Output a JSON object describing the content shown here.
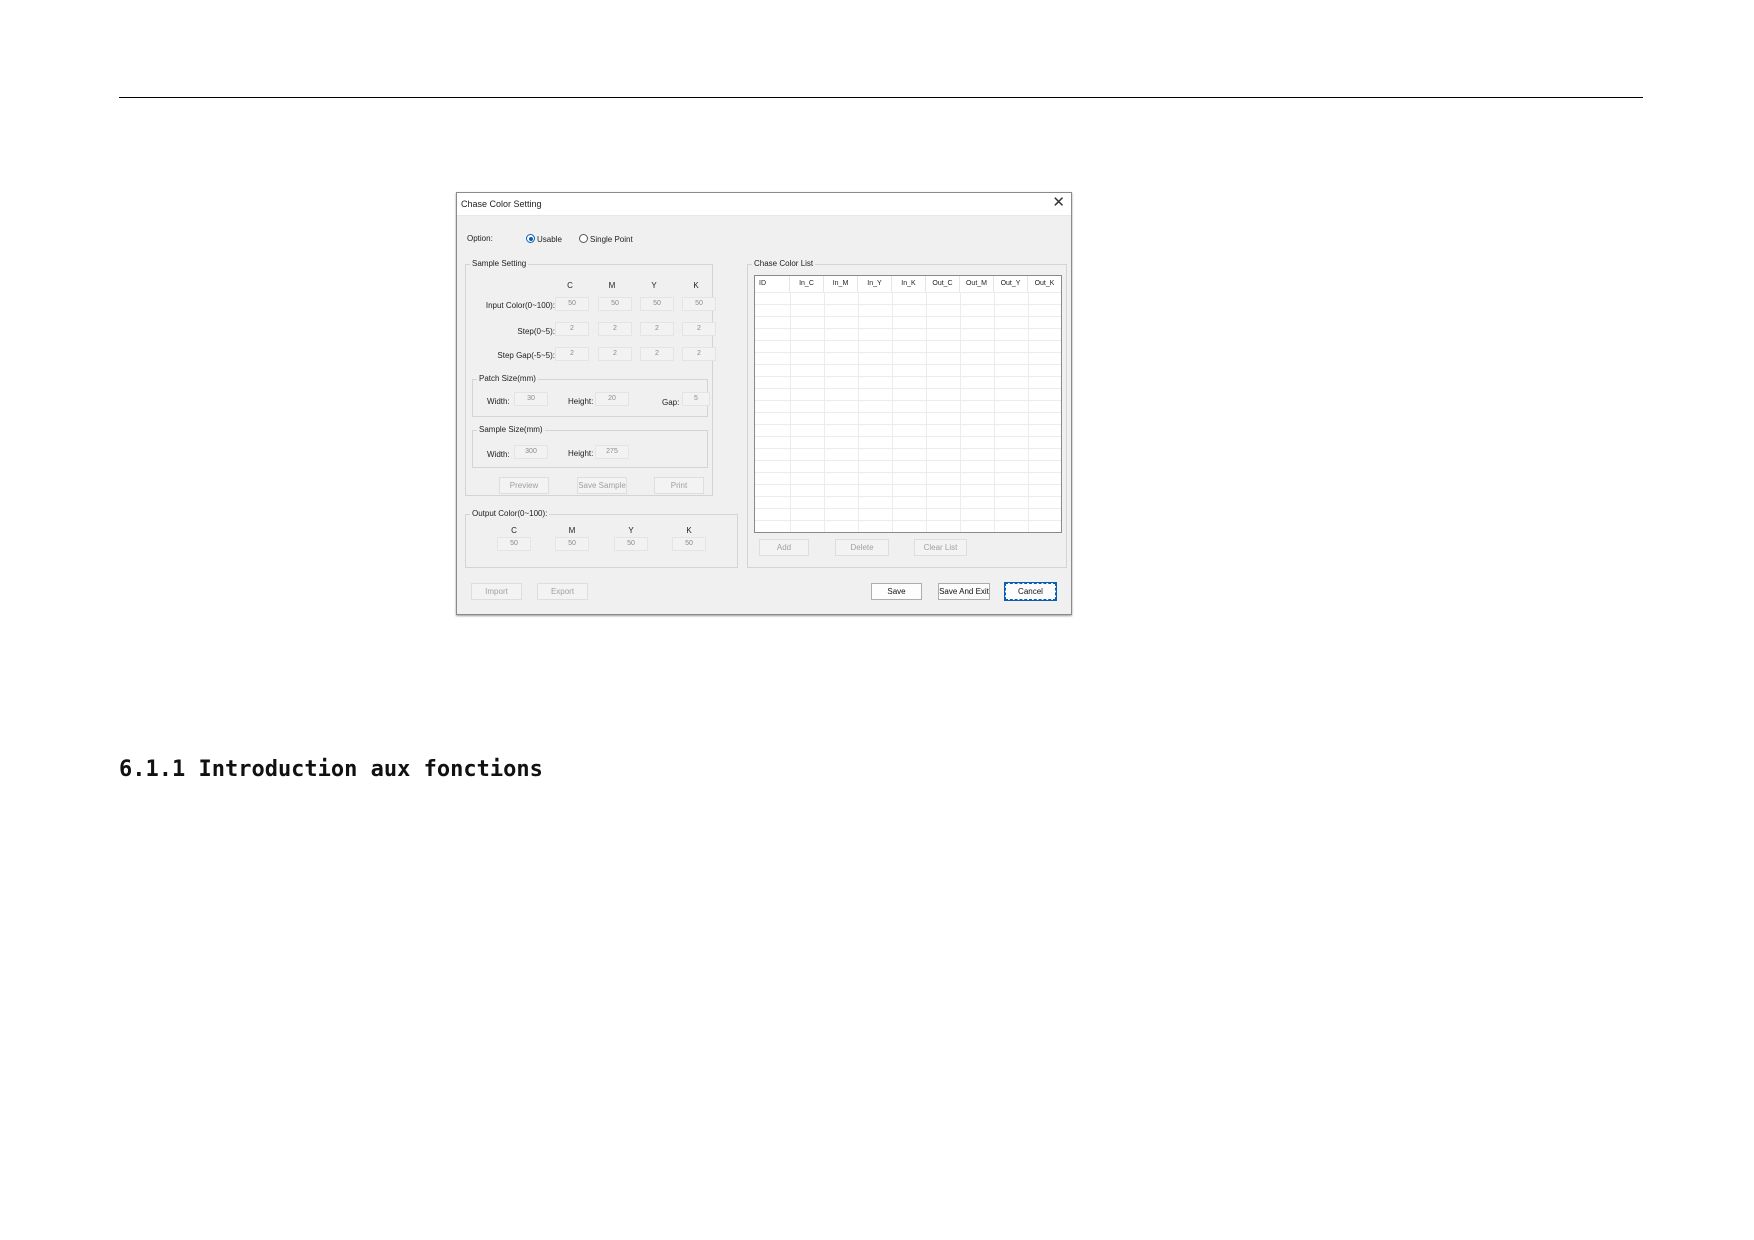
{
  "dialog": {
    "title": "Chase Color Setting",
    "close_glyph": "✕",
    "option_label": "Option:",
    "options": [
      {
        "label": "Usable",
        "selected": true
      },
      {
        "label": "Single Point",
        "selected": false
      }
    ],
    "sample_setting": {
      "title": "Sample Setting",
      "channels": [
        "C",
        "M",
        "Y",
        "K"
      ],
      "rows": [
        {
          "label": "Input Color(0~100):",
          "values": [
            "50",
            "50",
            "50",
            "50"
          ]
        },
        {
          "label": "Step(0~5):",
          "values": [
            "2",
            "2",
            "2",
            "2"
          ]
        },
        {
          "label": "Step Gap(-5~5):",
          "values": [
            "2",
            "2",
            "2",
            "2"
          ]
        }
      ],
      "patch_size": {
        "title": "Patch Size(mm)",
        "width_label": "Width:",
        "width_value": "30",
        "height_label": "Height:",
        "height_value": "20",
        "gap_label": "Gap:",
        "gap_value": "5"
      },
      "sample_size": {
        "title": "Sample Size(mm)",
        "width_label": "Width:",
        "width_value": "300",
        "height_label": "Height:",
        "height_value": "275"
      },
      "buttons": [
        "Preview",
        "Save Sample",
        "Print"
      ]
    },
    "output_color": {
      "title": "Output Color(0~100):",
      "channels": [
        "C",
        "M",
        "Y",
        "K"
      ],
      "values": [
        "50",
        "50",
        "50",
        "50"
      ]
    },
    "chase_list": {
      "title": "Chase Color List",
      "columns": [
        "ID",
        "In_C",
        "In_M",
        "In_Y",
        "In_K",
        "Out_C",
        "Out_M",
        "Out_Y",
        "Out_K"
      ],
      "buttons": [
        "Add",
        "Delete",
        "Clear List"
      ]
    },
    "footer": {
      "import_label": "Import",
      "export_label": "Export",
      "save_label": "Save",
      "save_exit_label": "Save And Exit",
      "cancel_label": "Cancel"
    },
    "colors": {
      "accent": "#0a5fb4",
      "disabled_text": "#a0a0a0",
      "dialog_bg": "#f0f0f0"
    }
  },
  "document": {
    "section_heading": "6.1.1 Introduction aux fonctions"
  }
}
